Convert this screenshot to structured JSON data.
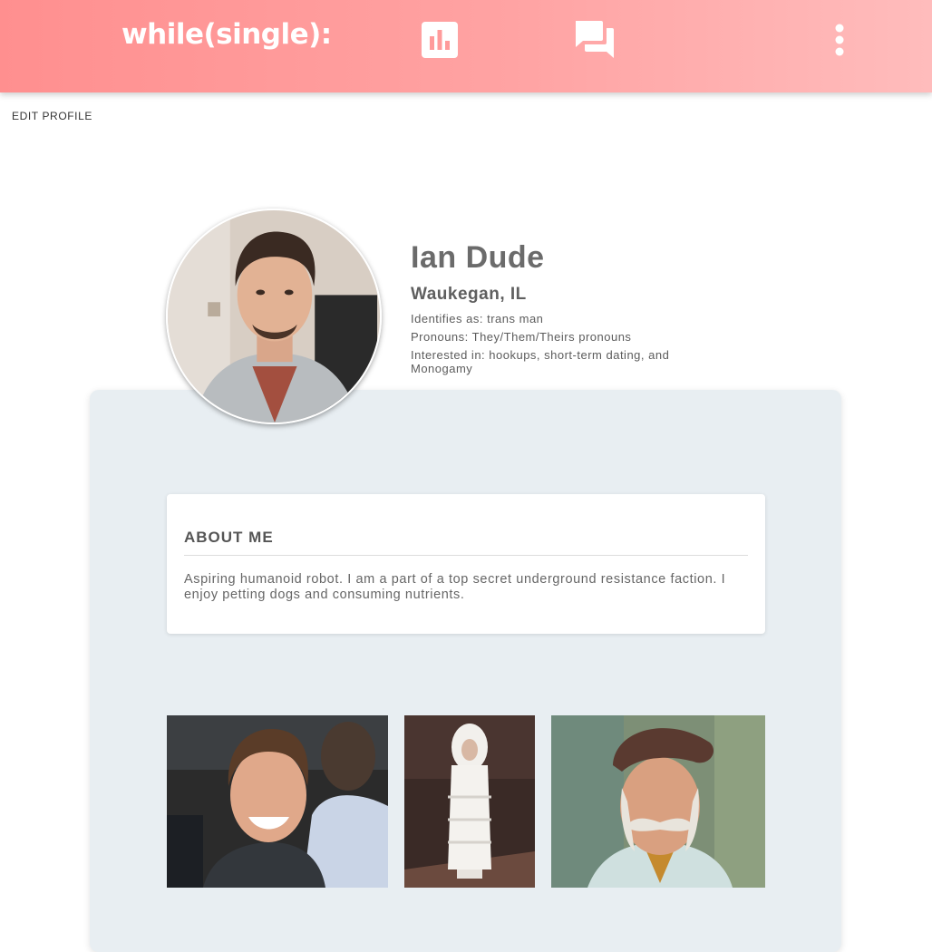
{
  "header": {
    "logo": "while(single):",
    "brand_gradient": [
      "#ff8f8f",
      "#ffbcbc"
    ],
    "nav": [
      {
        "name": "stats-icon"
      },
      {
        "name": "chat-icon"
      },
      {
        "name": "more-vertical-icon"
      }
    ]
  },
  "edit_profile_label": "EDIT PROFILE",
  "profile": {
    "name": "Ian Dude",
    "location": "Waukegan, IL",
    "identifies": "Identifies as: trans man",
    "pronouns": "Pronouns: They/Them/Theirs pronouns",
    "interested": "Interested in: hookups, short-term dating, and Monogamy"
  },
  "about": {
    "title": "ABOUT ME",
    "text": "Aspiring humanoid robot. I am a part of a top secret underground resistance faction. I enjoy petting dogs and consuming nutrients."
  },
  "photos": [
    {
      "name": "photo-smiling-man"
    },
    {
      "name": "photo-white-costume"
    },
    {
      "name": "photo-man-in-beret"
    }
  ],
  "colors": {
    "card_background": "#e8eef2",
    "text": "#666666"
  }
}
